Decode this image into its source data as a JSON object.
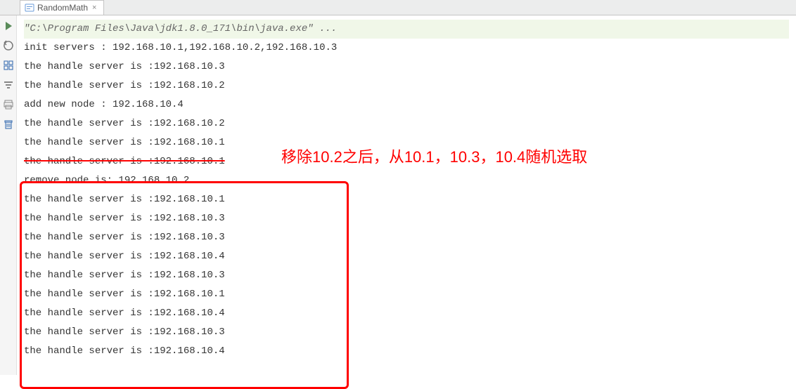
{
  "tab": {
    "label": "RandomMath",
    "close": "×"
  },
  "console": {
    "cmd": "\"C:\\Program Files\\Java\\jdk1.8.0_171\\bin\\java.exe\" ...",
    "lines": [
      {
        "text": "init servers : 192.168.10.1,192.168.10.2,192.168.10.3",
        "strike": false
      },
      {
        "text": "the handle server is :192.168.10.3",
        "strike": false
      },
      {
        "text": "the handle server is :192.168.10.2",
        "strike": false
      },
      {
        "text": "add new node : 192.168.10.4",
        "strike": false
      },
      {
        "text": "the handle server is :192.168.10.2",
        "strike": false
      },
      {
        "text": "the handle server is :192.168.10.1",
        "strike": false
      },
      {
        "text": "the handle server is :192.168.10.1",
        "strike": true
      },
      {
        "text": "remove node is: 192.168.10.2",
        "strike": false
      },
      {
        "text": "the handle server is :192.168.10.1",
        "strike": false
      },
      {
        "text": "the handle server is :192.168.10.3",
        "strike": false
      },
      {
        "text": "the handle server is :192.168.10.3",
        "strike": false
      },
      {
        "text": "the handle server is :192.168.10.4",
        "strike": false
      },
      {
        "text": "the handle server is :192.168.10.3",
        "strike": false
      },
      {
        "text": "the handle server is :192.168.10.1",
        "strike": false
      },
      {
        "text": "the handle server is :192.168.10.4",
        "strike": false
      },
      {
        "text": "the handle server is :192.168.10.3",
        "strike": false
      },
      {
        "text": "the handle server is :192.168.10.4",
        "strike": false
      }
    ]
  },
  "annotation": "移除10.2之后，从10.1，10.3，10.4随机选取"
}
